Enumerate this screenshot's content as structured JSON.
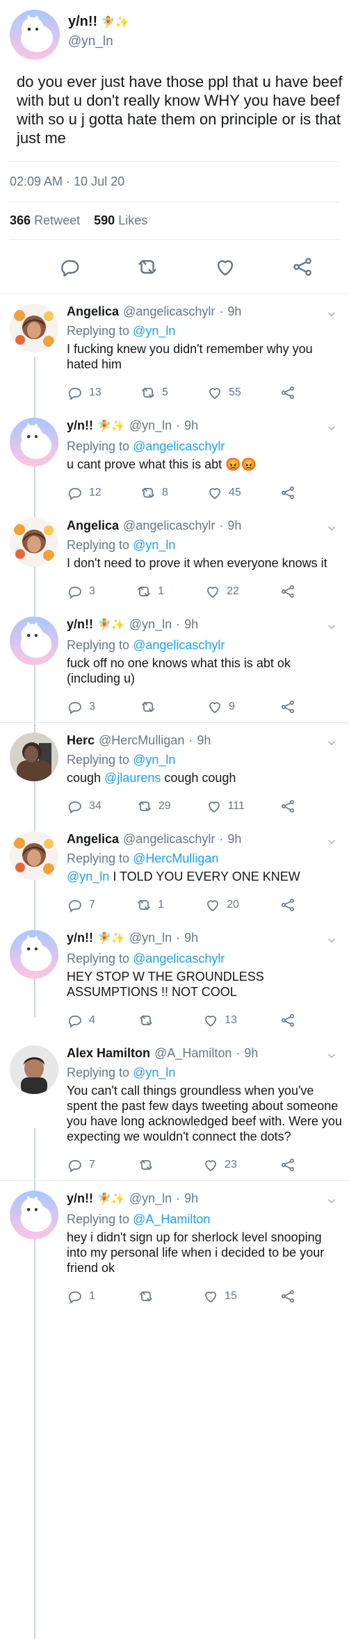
{
  "colors": {
    "blue": "#1da1f2",
    "text": "#14171a",
    "muted": "#657786",
    "line": "#e6ecf0"
  },
  "main_tweet": {
    "author": {
      "name": "y/n!!",
      "handle": "@yn_ln",
      "name_emojis": "🧚✨"
    },
    "text": "do you ever just have those ppl that u have beef with but u don't really know WHY you have beef with so u j gotta hate them on principle or is that just me",
    "timestamp": "02:09 AM · 10 Jul 20",
    "retweets": "366",
    "retweets_label": "Retweet",
    "likes": "590",
    "likes_label": "Likes",
    "actions": [
      {
        "icon": "reply-icon"
      },
      {
        "icon": "retweet-icon"
      },
      {
        "icon": "like-icon"
      },
      {
        "icon": "share-icon"
      }
    ]
  },
  "replies": [
    {
      "name": "Angelica",
      "handle": "@angelicaschylr",
      "time": "9h",
      "replying_to": "@yn_ln",
      "text": "I fucking knew you didn't remember why you hated him",
      "stats": {
        "replies": "13",
        "retweets": "5",
        "likes": "55"
      },
      "avatar": "angelica"
    },
    {
      "name": "y/n!!",
      "name_emojis": "🧚✨",
      "handle": "@yn_ln",
      "time": "9h",
      "replying_to": "@angelicaschylr",
      "text": "u cant prove what this is abt 😡😡",
      "stats": {
        "replies": "12",
        "retweets": "8",
        "likes": "45"
      },
      "avatar": "yn"
    },
    {
      "name": "Angelica",
      "handle": "@angelicaschylr",
      "time": "9h",
      "replying_to": "@yn_ln",
      "text": "I don't need to prove it when everyone knows it",
      "stats": {
        "replies": "3",
        "retweets": "1",
        "likes": "22"
      },
      "avatar": "angelica"
    },
    {
      "name": "y/n!!",
      "name_emojis": "🧚✨",
      "handle": "@yn_ln",
      "time": "9h",
      "replying_to": "@angelicaschylr",
      "text": "fuck off no one knows what this is abt ok (including u)",
      "stats": {
        "replies": "3",
        "retweets": "",
        "likes": "9"
      },
      "avatar": "yn"
    },
    {
      "name": "Herc",
      "handle": "@HercMulligan",
      "time": "9h",
      "replying_to": "@yn_ln",
      "text": "cough @jlaurens cough cough",
      "stats": {
        "replies": "34",
        "retweets": "29",
        "likes": "111"
      },
      "avatar": "herc"
    },
    {
      "name": "Angelica",
      "handle": "@angelicaschylr",
      "time": "9h",
      "replying_to": "@HercMulligan",
      "text": "@yn_ln I TOLD YOU EVERY ONE KNEW",
      "stats": {
        "replies": "7",
        "retweets": "1",
        "likes": "20"
      },
      "avatar": "angelica"
    },
    {
      "name": "y/n!!",
      "name_emojis": "🧚✨",
      "handle": "@yn_ln",
      "time": "9h",
      "replying_to": "@angelicaschylr",
      "text": "HEY STOP W THE GROUNDLESS ASSUMPTIONS !! NOT COOL",
      "stats": {
        "replies": "4",
        "retweets": "",
        "likes": "13"
      },
      "avatar": "yn"
    },
    {
      "name": "Alex Hamilton",
      "handle": "@A_Hamilton",
      "time": "9h",
      "replying_to": "@yn_ln",
      "text": "You can't call things groundless when you've spent the past few days tweeting about someone you have long acknowledged beef with. Were you expecting we wouldn't connect the dots?",
      "stats": {
        "replies": "7",
        "retweets": "",
        "likes": "23"
      },
      "avatar": "alex"
    },
    {
      "name": "y/n!!",
      "name_emojis": "🧚✨",
      "handle": "@yn_ln",
      "time": "9h",
      "replying_to": "@A_Hamilton",
      "text": "hey i didn't sign up for sherlock level snooping into my personal life when i decided to be your friend ok",
      "stats": {
        "replies": "1",
        "retweets": "",
        "likes": "15"
      },
      "avatar": "yn"
    }
  ],
  "labels": {
    "replying_to": "Replying to"
  }
}
